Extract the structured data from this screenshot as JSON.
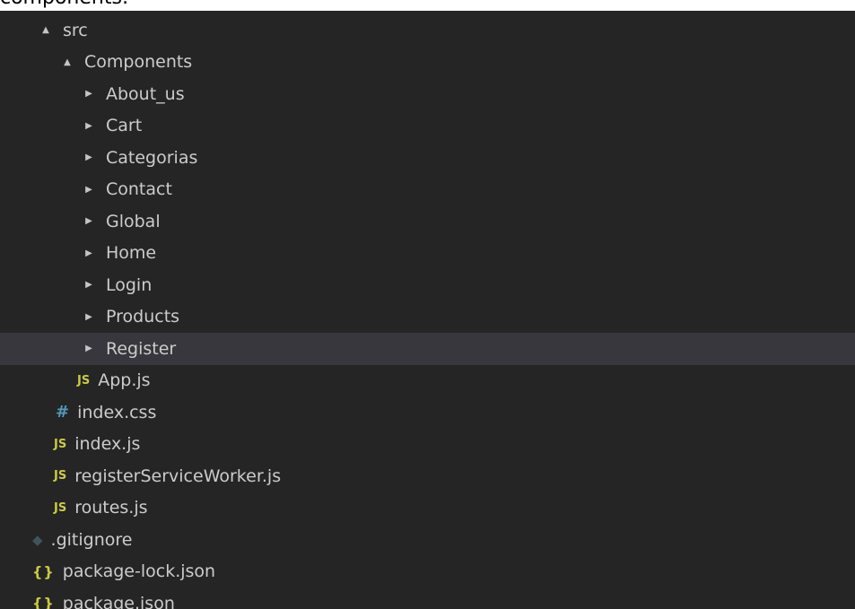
{
  "caption": "components:",
  "tree": {
    "items": [
      {
        "label": "src",
        "kind": "folder",
        "expanded": true,
        "twisty": "▲",
        "icon": ""
      },
      {
        "label": "Components",
        "kind": "folder",
        "expanded": true,
        "twisty": "▲",
        "icon": ""
      },
      {
        "label": "About_us",
        "kind": "folder",
        "expanded": false,
        "twisty": "▶",
        "icon": ""
      },
      {
        "label": "Cart",
        "kind": "folder",
        "expanded": false,
        "twisty": "▶",
        "icon": ""
      },
      {
        "label": "Categorias",
        "kind": "folder",
        "expanded": false,
        "twisty": "▶",
        "icon": ""
      },
      {
        "label": "Contact",
        "kind": "folder",
        "expanded": false,
        "twisty": "▶",
        "icon": ""
      },
      {
        "label": "Global",
        "kind": "folder",
        "expanded": false,
        "twisty": "▶",
        "icon": ""
      },
      {
        "label": "Home",
        "kind": "folder",
        "expanded": false,
        "twisty": "▶",
        "icon": ""
      },
      {
        "label": "Login",
        "kind": "folder",
        "expanded": false,
        "twisty": "▶",
        "icon": ""
      },
      {
        "label": "Products",
        "kind": "folder",
        "expanded": false,
        "twisty": "▶",
        "icon": ""
      },
      {
        "label": "Register",
        "kind": "folder",
        "expanded": false,
        "twisty": "▶",
        "icon": "",
        "selected": true
      },
      {
        "label": "App.js",
        "kind": "file",
        "twisty": "",
        "icon": "JS",
        "icon_name": "js-file-icon"
      },
      {
        "label": "index.css",
        "kind": "file",
        "twisty": "",
        "icon": "#",
        "icon_name": "css-file-icon"
      },
      {
        "label": "index.js",
        "kind": "file",
        "twisty": "",
        "icon": "JS",
        "icon_name": "js-file-icon"
      },
      {
        "label": "registerServiceWorker.js",
        "kind": "file",
        "twisty": "",
        "icon": "JS",
        "icon_name": "js-file-icon"
      },
      {
        "label": "routes.js",
        "kind": "file",
        "twisty": "",
        "icon": "JS",
        "icon_name": "js-file-icon"
      },
      {
        "label": ".gitignore",
        "kind": "file",
        "twisty": "",
        "icon": "◆",
        "icon_name": "git-file-icon"
      },
      {
        "label": "package-lock.json",
        "kind": "file",
        "twisty": "",
        "icon": "{}",
        "icon_name": "json-file-icon"
      },
      {
        "label": "package.json",
        "kind": "file",
        "twisty": "",
        "icon": "{}",
        "icon_name": "json-file-icon"
      }
    ]
  },
  "colors": {
    "background": "#252526",
    "selected_row": "#37373d",
    "text": "#cccccc",
    "js_icon": "#cbcb41",
    "css_icon": "#519aba",
    "json_icon": "#cbcb41",
    "git_icon": "#41535b"
  }
}
